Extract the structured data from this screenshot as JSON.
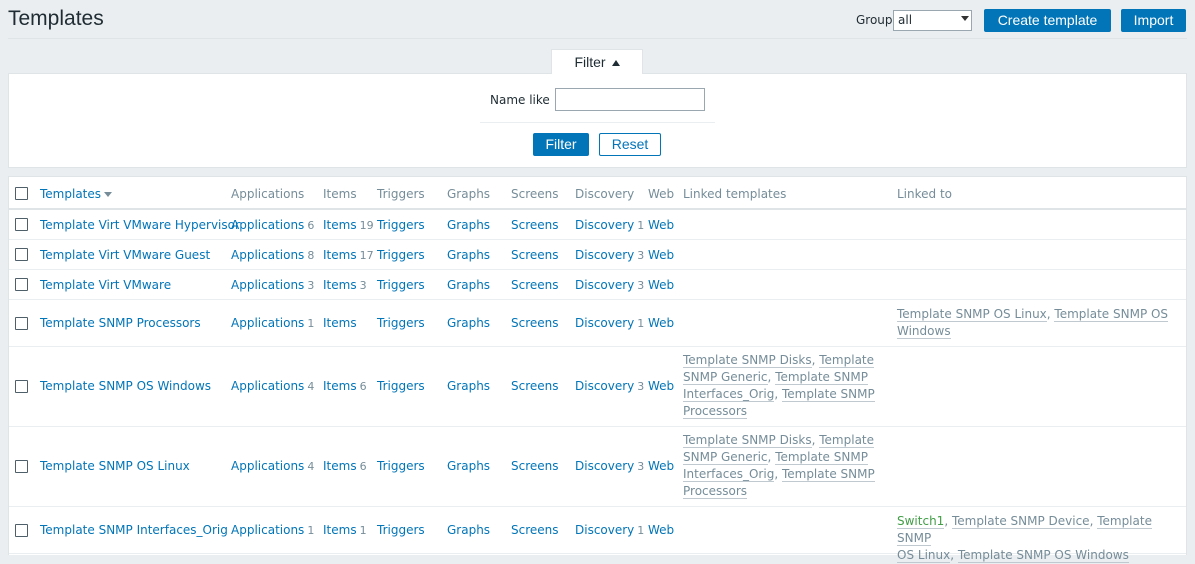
{
  "header": {
    "title": "Templates",
    "group_label": "Group",
    "group_value": "all",
    "create_button": "Create template",
    "import_button": "Import"
  },
  "filter": {
    "tab_label": "Filter",
    "name_like_label": "Name like",
    "name_like_value": "",
    "filter_button": "Filter",
    "reset_button": "Reset"
  },
  "table": {
    "columns": {
      "templates": "Templates",
      "applications": "Applications",
      "items": "Items",
      "triggers": "Triggers",
      "graphs": "Graphs",
      "screens": "Screens",
      "discovery": "Discovery",
      "web": "Web",
      "linked_templates": "Linked templates",
      "linked_to": "Linked to"
    },
    "rows": [
      {
        "name": "Template Virt VMware Hypervisor",
        "applications": "Applications",
        "app_count": "6",
        "items": "Items",
        "items_count": "19",
        "triggers": "Triggers",
        "graphs": "Graphs",
        "screens": "Screens",
        "discovery": "Discovery",
        "disc_count": "1",
        "web": "Web"
      },
      {
        "name": "Template Virt VMware Guest",
        "applications": "Applications",
        "app_count": "8",
        "items": "Items",
        "items_count": "17",
        "triggers": "Triggers",
        "graphs": "Graphs",
        "screens": "Screens",
        "discovery": "Discovery",
        "disc_count": "3",
        "web": "Web"
      },
      {
        "name": "Template Virt VMware",
        "applications": "Applications",
        "app_count": "3",
        "items": "Items",
        "items_count": "3",
        "triggers": "Triggers",
        "graphs": "Graphs",
        "screens": "Screens",
        "discovery": "Discovery",
        "disc_count": "3",
        "web": "Web"
      },
      {
        "name": "Template SNMP Processors",
        "applications": "Applications",
        "app_count": "1",
        "items": "Items",
        "items_count": "",
        "triggers": "Triggers",
        "graphs": "Graphs",
        "screens": "Screens",
        "discovery": "Discovery",
        "disc_count": "1",
        "web": "Web",
        "linked_to": [
          "Template SNMP OS Linux",
          ", ",
          "Template SNMP OS",
          "Windows"
        ]
      },
      {
        "name": "Template SNMP OS Windows",
        "applications": "Applications",
        "app_count": "4",
        "items": "Items",
        "items_count": "6",
        "triggers": "Triggers",
        "graphs": "Graphs",
        "screens": "Screens",
        "discovery": "Discovery",
        "disc_count": "3",
        "web": "Web",
        "linked_templates": [
          "Template SNMP Disks",
          ", ",
          "Template",
          "SNMP Generic",
          ", ",
          "Template SNMP",
          "Interfaces_Orig",
          ", ",
          "Template SNMP",
          "Processors"
        ]
      },
      {
        "name": "Template SNMP OS Linux",
        "applications": "Applications",
        "app_count": "4",
        "items": "Items",
        "items_count": "6",
        "triggers": "Triggers",
        "graphs": "Graphs",
        "screens": "Screens",
        "discovery": "Discovery",
        "disc_count": "3",
        "web": "Web",
        "linked_templates": [
          "Template SNMP Disks",
          ", ",
          "Template",
          "SNMP Generic",
          ", ",
          "Template SNMP",
          "Interfaces_Orig",
          ", ",
          "Template SNMP",
          "Processors"
        ]
      },
      {
        "name": "Template SNMP Interfaces_Orig",
        "applications": "Applications",
        "app_count": "1",
        "items": "Items",
        "items_count": "1",
        "triggers": "Triggers",
        "graphs": "Graphs",
        "screens": "Screens",
        "discovery": "Discovery",
        "disc_count": "1",
        "web": "Web",
        "linked_to": [
          "Switch1",
          ", ",
          "Template SNMP Device",
          ", ",
          "Template SNMP",
          "OS Linux",
          ", ",
          "Template SNMP OS Windows"
        ]
      }
    ]
  },
  "colors": {
    "link": "#0275b8",
    "muted": "#768d99",
    "host_green": "#429e47"
  }
}
